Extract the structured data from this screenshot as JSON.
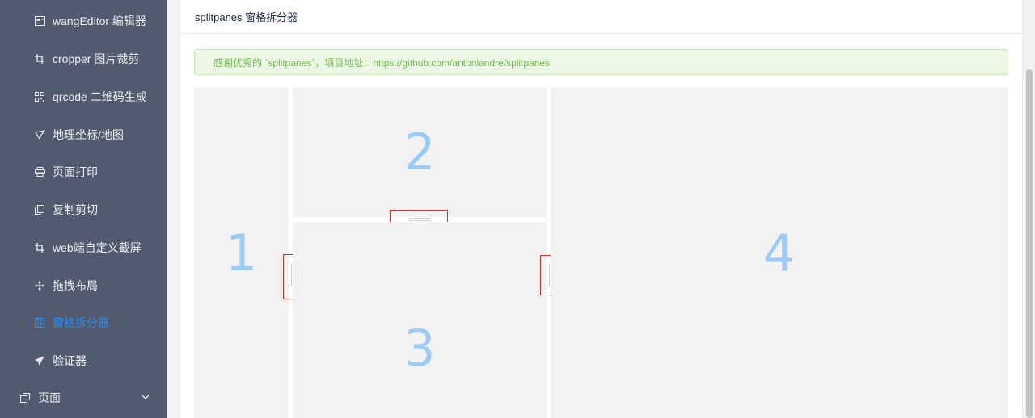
{
  "sidebar": {
    "items": [
      {
        "label": "wangEditor 编辑器",
        "icon": "editor-icon"
      },
      {
        "label": "cropper 图片裁剪",
        "icon": "crop-icon"
      },
      {
        "label": "qrcode 二维码生成",
        "icon": "qrcode-icon"
      },
      {
        "label": "地理坐标/地图",
        "icon": "map-pin-icon"
      },
      {
        "label": "页面打印",
        "icon": "printer-icon"
      },
      {
        "label": "复制剪切",
        "icon": "copy-icon"
      },
      {
        "label": "web端自定义截屏",
        "icon": "crop-icon"
      },
      {
        "label": "拖拽布局",
        "icon": "move-icon"
      },
      {
        "label": "窗格拆分器",
        "icon": "columns-icon",
        "active": true
      },
      {
        "label": "验证器",
        "icon": "send-icon"
      }
    ],
    "group": {
      "label": "页面",
      "icon": "page-icon"
    }
  },
  "header": {
    "title": "splitpanes 窗格拆分器"
  },
  "alert": {
    "text": "感谢优秀的 `splitpanes`，项目地址：https://github.com/antoniandre/splitpanes"
  },
  "panes": {
    "p1": "1",
    "p2": "2",
    "p3": "3",
    "p4": "4"
  },
  "colors": {
    "sidebar": "#515a6e",
    "active": "#2d8cf0",
    "pane_bg": "#f2f2f2",
    "pane_text": "#9ecbf5",
    "alert_text": "#6fbd4b"
  }
}
